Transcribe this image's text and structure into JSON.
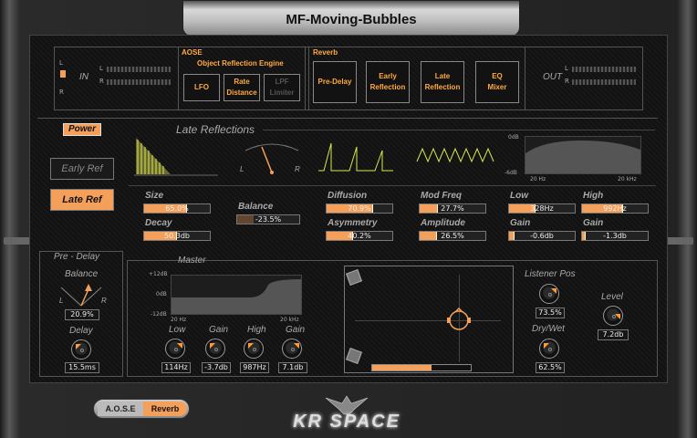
{
  "title": "MF-Moving-Bubbles",
  "input": {
    "label": "IN",
    "l": "L",
    "r": "R"
  },
  "output": {
    "label": "OUT",
    "l": "L",
    "r": "R"
  },
  "aose": {
    "header": "AOSE",
    "subheader": "Object Reflection Engine",
    "buttons": [
      "LFO",
      "Rate\nDistance",
      "LPF\nLimiter"
    ]
  },
  "reverb": {
    "header": "Reverb",
    "buttons": [
      "Pre-Delay",
      "Early\nReflection",
      "Late\nReflection",
      "EQ\nMixer"
    ]
  },
  "late": {
    "power": "Power",
    "section_title": "Late Reflections",
    "early_btn": "Early Ref",
    "late_btn": "Late Ref",
    "balance_graph": {
      "l": "L",
      "r": "R"
    },
    "eq_graph": {
      "top": "0dB",
      "bottom": "-6dB",
      "left": "20 Hz",
      "right": "20 kHz"
    },
    "params": {
      "size": {
        "label": "Size",
        "value": "65.0%",
        "fill": 0.65
      },
      "decay": {
        "label": "Decay",
        "value": "50.3db",
        "fill": 0.5
      },
      "balance": {
        "label": "Balance",
        "value": "-23.5%",
        "fill": 0.38
      },
      "diffusion": {
        "label": "Diffusion",
        "value": "70.9%",
        "fill": 0.71
      },
      "asymmetry": {
        "label": "Asymmetry",
        "value": "40.2%",
        "fill": 0.4
      },
      "modfreq": {
        "label": "Mod Freq",
        "value": "27.7%",
        "fill": 0.28
      },
      "amplitude": {
        "label": "Amplitude",
        "value": "26.5%",
        "fill": 0.27
      },
      "low": {
        "label": "Low",
        "value": "328Hz",
        "fill": 0.4
      },
      "high": {
        "label": "High",
        "value": "992Hz",
        "fill": 0.62
      },
      "gain_low": {
        "label": "Gain",
        "value": "-0.6db",
        "fill": 0.08
      },
      "gain_high": {
        "label": "Gain",
        "value": "-1.3db",
        "fill": 0.06
      }
    }
  },
  "predelay": {
    "title": "Pre - Delay",
    "balance_label": "Balance",
    "balance_value": "20.9%",
    "l": "L",
    "r": "R",
    "delay_label": "Delay",
    "delay_value": "15.5ms"
  },
  "master": {
    "title": "Master",
    "graph": {
      "top": "+12dB",
      "mid": "0dB",
      "bottom": "-12dB",
      "left": "20 Hz",
      "right": "20 kHz"
    },
    "knobs": [
      {
        "label": "Low",
        "value": "114Hz"
      },
      {
        "label": "Gain",
        "value": "-3.7db"
      },
      {
        "label": "High",
        "value": "987Hz"
      },
      {
        "label": "Gain",
        "value": "7.1db"
      }
    ]
  },
  "listener": {
    "label": "Listener Pos",
    "value": "73.5%",
    "drywet_label": "Dry/Wet",
    "drywet_value": "62.5%",
    "level_label": "Level",
    "level_value": "7.2db",
    "progress": 0.6
  },
  "nav": {
    "aose": "A.O.S.E",
    "reverb": "Reverb"
  },
  "logo": "KR SPACE",
  "colors": {
    "accent": "#f4a05a",
    "accent_text": "#ffaa44"
  }
}
